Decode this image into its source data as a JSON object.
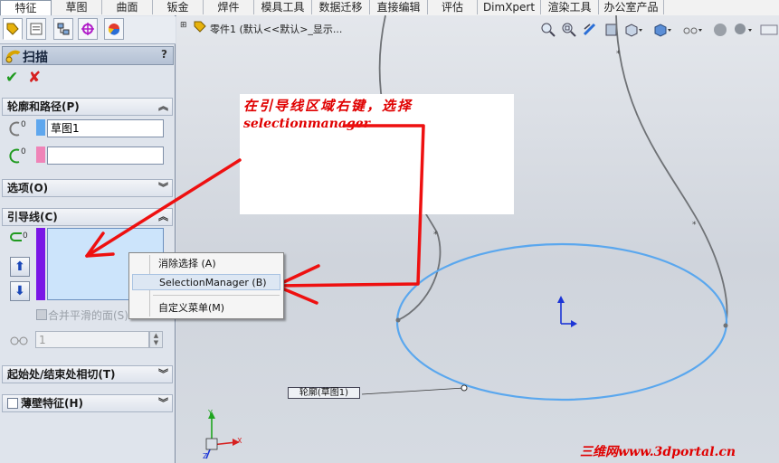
{
  "tabs": [
    "特征",
    "草图",
    "曲面",
    "钣金",
    "焊件",
    "模具工具",
    "数据迁移",
    "直接编辑",
    "评估",
    "DimXpert",
    "渲染工具",
    "办公室产品"
  ],
  "active_tab": "特征",
  "feature": {
    "title": "扫描",
    "help": "?",
    "ok": "✔",
    "cancel": "✘"
  },
  "sections": {
    "profile_path": "轮廓和路径(P)",
    "options": "选项(O)",
    "guide_curves": "引导线(C)",
    "tangency": "起始处/结束处相切(T)",
    "thin": "薄壁特征(H)"
  },
  "fields": {
    "profile_value": "草图1",
    "path_value": "",
    "count_value": "1"
  },
  "merge_label": "合并平滑的面(S)",
  "tree_label": "零件1 (默认<<默认>_显示...",
  "context_menu": {
    "items": [
      "消除选择 (A)",
      "SelectionManager (B)",
      "自定义菜单(M)"
    ]
  },
  "callout": {
    "line1": "在引导线区域右键，选择",
    "line2": "selectionmanager"
  },
  "profile_label": "轮廓(草图1)",
  "watermark": "三维网www.3dportal.cn",
  "axes": {
    "x": "X",
    "y": "Y",
    "z": "Z"
  },
  "colors": {
    "accent": "#3a8ee8",
    "annotation": "#e00000",
    "guide_bar": "#7a16e6"
  }
}
